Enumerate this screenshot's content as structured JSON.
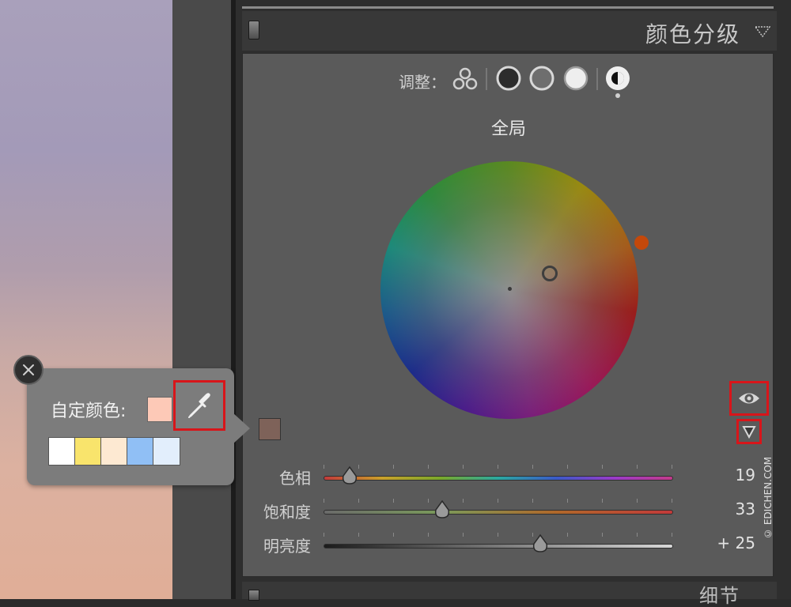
{
  "panel": {
    "title": "颜色分级",
    "next_section_title": "细节"
  },
  "adjust": {
    "label": "调整：",
    "modes": [
      {
        "id": "three-way",
        "icon": "three-circles-icon"
      },
      {
        "id": "shadows",
        "icon": "dark-circle-icon"
      },
      {
        "id": "midtones",
        "icon": "mid-circle-icon"
      },
      {
        "id": "highlights",
        "icon": "light-circle-icon"
      },
      {
        "id": "global",
        "icon": "half-circle-icon",
        "selected": true
      }
    ]
  },
  "region_title": "全局",
  "sliders": [
    {
      "label": "色相",
      "value": "19",
      "fraction": 0.075
    },
    {
      "label": "饱和度",
      "value": "33",
      "fraction": 0.34
    },
    {
      "label": "明亮度",
      "value": "+ 25",
      "fraction": 0.62
    }
  ],
  "popover": {
    "custom_label": "自定颜色:",
    "custom_color": "#fdc9b7",
    "presets": [
      "#ffffff",
      "#f9e46c",
      "#fde9d2",
      "#90bff5",
      "#e2eefc"
    ]
  },
  "selected_color": "#7e6259",
  "accent_color": "#d8151a",
  "watermark": "© EDICHEN.COM"
}
